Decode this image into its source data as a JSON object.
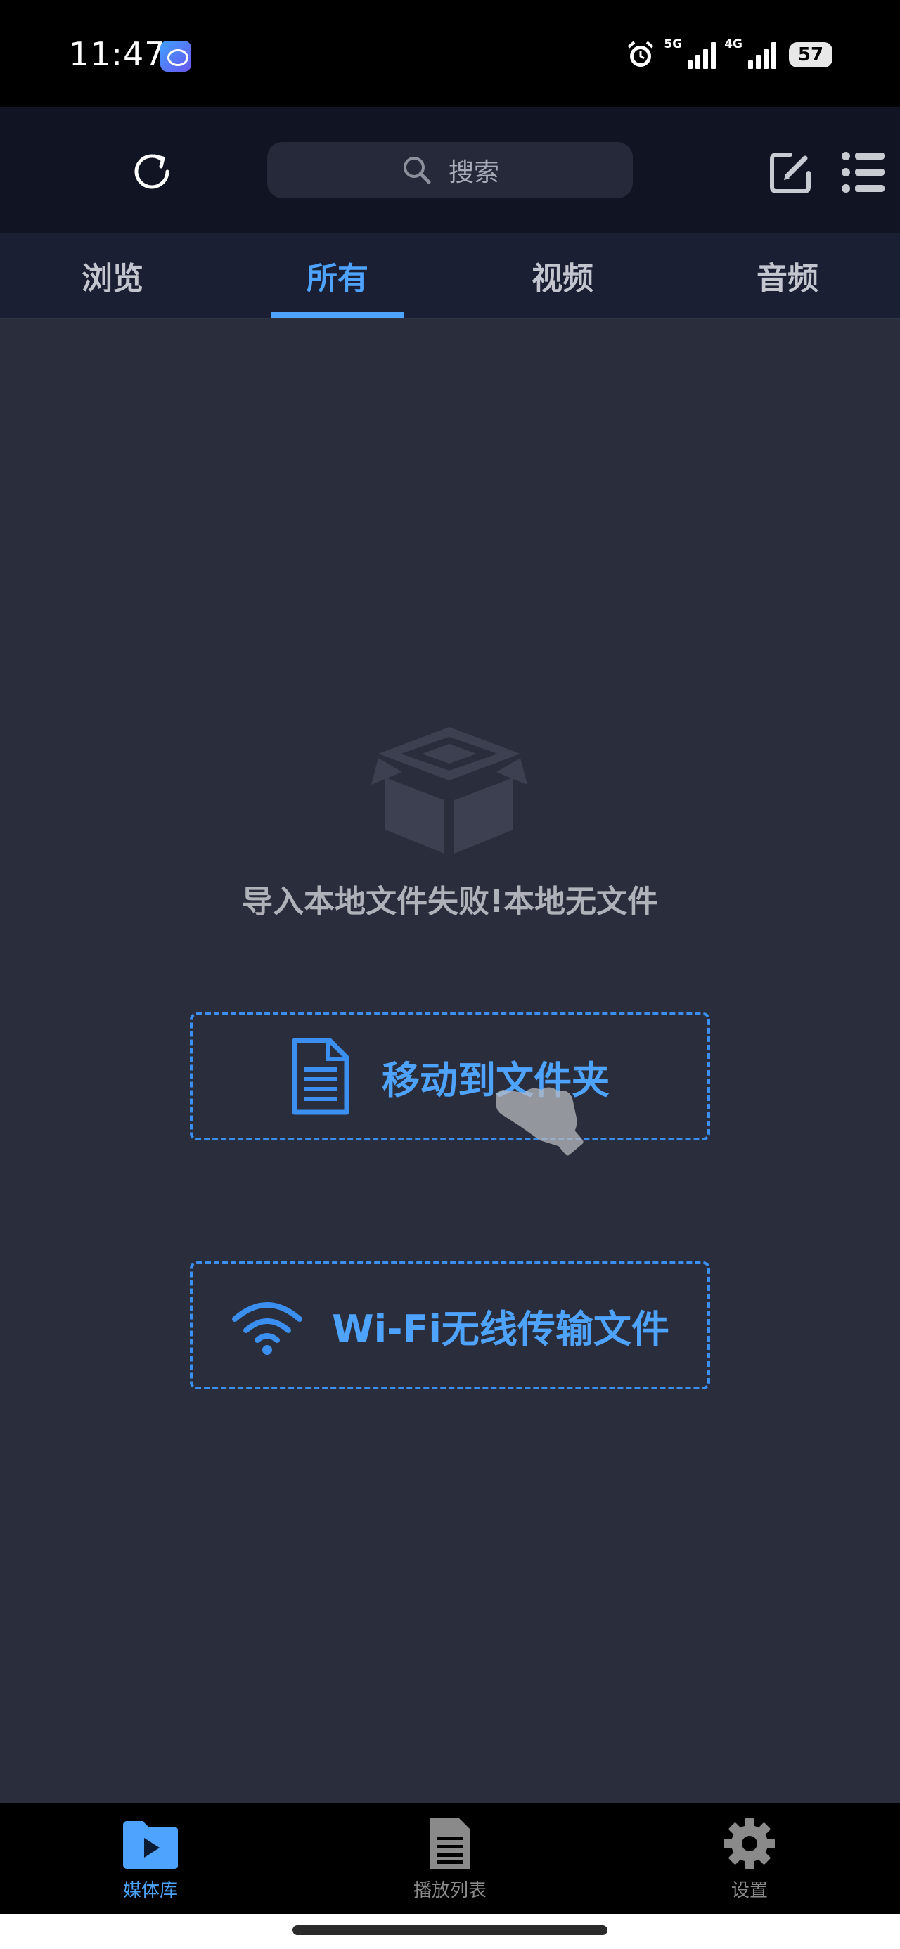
{
  "status_bar": {
    "time": "11:47",
    "network_1": "5G",
    "network_2": "4G",
    "battery": "57"
  },
  "toolbar": {
    "search_placeholder": "搜索"
  },
  "tabs": [
    {
      "label": "浏览",
      "active": false
    },
    {
      "label": "所有",
      "active": true
    },
    {
      "label": "视频",
      "active": false
    },
    {
      "label": "音频",
      "active": false
    }
  ],
  "empty_state": {
    "message": "导入本地文件失败!本地无文件"
  },
  "actions": {
    "move_to_folder": "移动到文件夹",
    "wifi_transfer": "Wi-Fi无线传输文件"
  },
  "bottom_nav": [
    {
      "label": "媒体库",
      "icon": "play-icon",
      "active": true
    },
    {
      "label": "播放列表",
      "icon": "document-icon",
      "active": false
    },
    {
      "label": "设置",
      "icon": "gear-icon",
      "active": false
    }
  ],
  "colors": {
    "accent": "#4ea3ff",
    "background": "#2a2d3b",
    "toolbar": "#101423",
    "tabs_bar": "#1a1f33"
  }
}
